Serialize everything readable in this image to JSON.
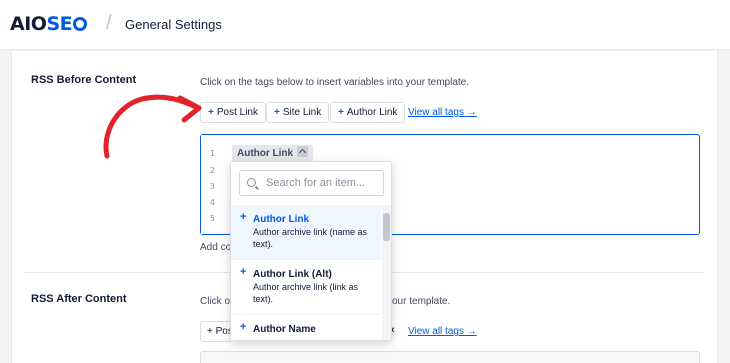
{
  "header": {
    "logo_main": "AIO",
    "logo_accent": "SE",
    "separator": "/",
    "page_title": "General Settings"
  },
  "colors": {
    "accent": "#005ae0",
    "annotation_arrow": "#e3232b"
  },
  "rss_before": {
    "label": "RSS Before Content",
    "description": "Click on the tags below to insert variables into your template.",
    "tags": [
      {
        "plus": "+",
        "label": "Post Link"
      },
      {
        "plus": "+",
        "label": "Site Link"
      },
      {
        "plus": "+",
        "label": "Author Link"
      }
    ],
    "view_all": "View all tags →",
    "line_numbers": [
      "1",
      "2",
      "3",
      "4",
      "5"
    ],
    "inserted_tag": "Author Link",
    "helper_text": "Add co"
  },
  "dropdown": {
    "search_placeholder": "Search for an item...",
    "items": [
      {
        "plus": "+",
        "name": "Author Link",
        "description": "Author archive link (name as text)."
      },
      {
        "plus": "+",
        "name": "Author Link (Alt)",
        "description": "Author archive link (link as text)."
      },
      {
        "plus": "+",
        "name": "Author Name",
        "description": ""
      }
    ]
  },
  "rss_after": {
    "label": "RSS After Content",
    "description_start": "Click on",
    "description_end": "our template.",
    "first_tag_fragment": "+ Post",
    "view_all": "View all tags →"
  }
}
